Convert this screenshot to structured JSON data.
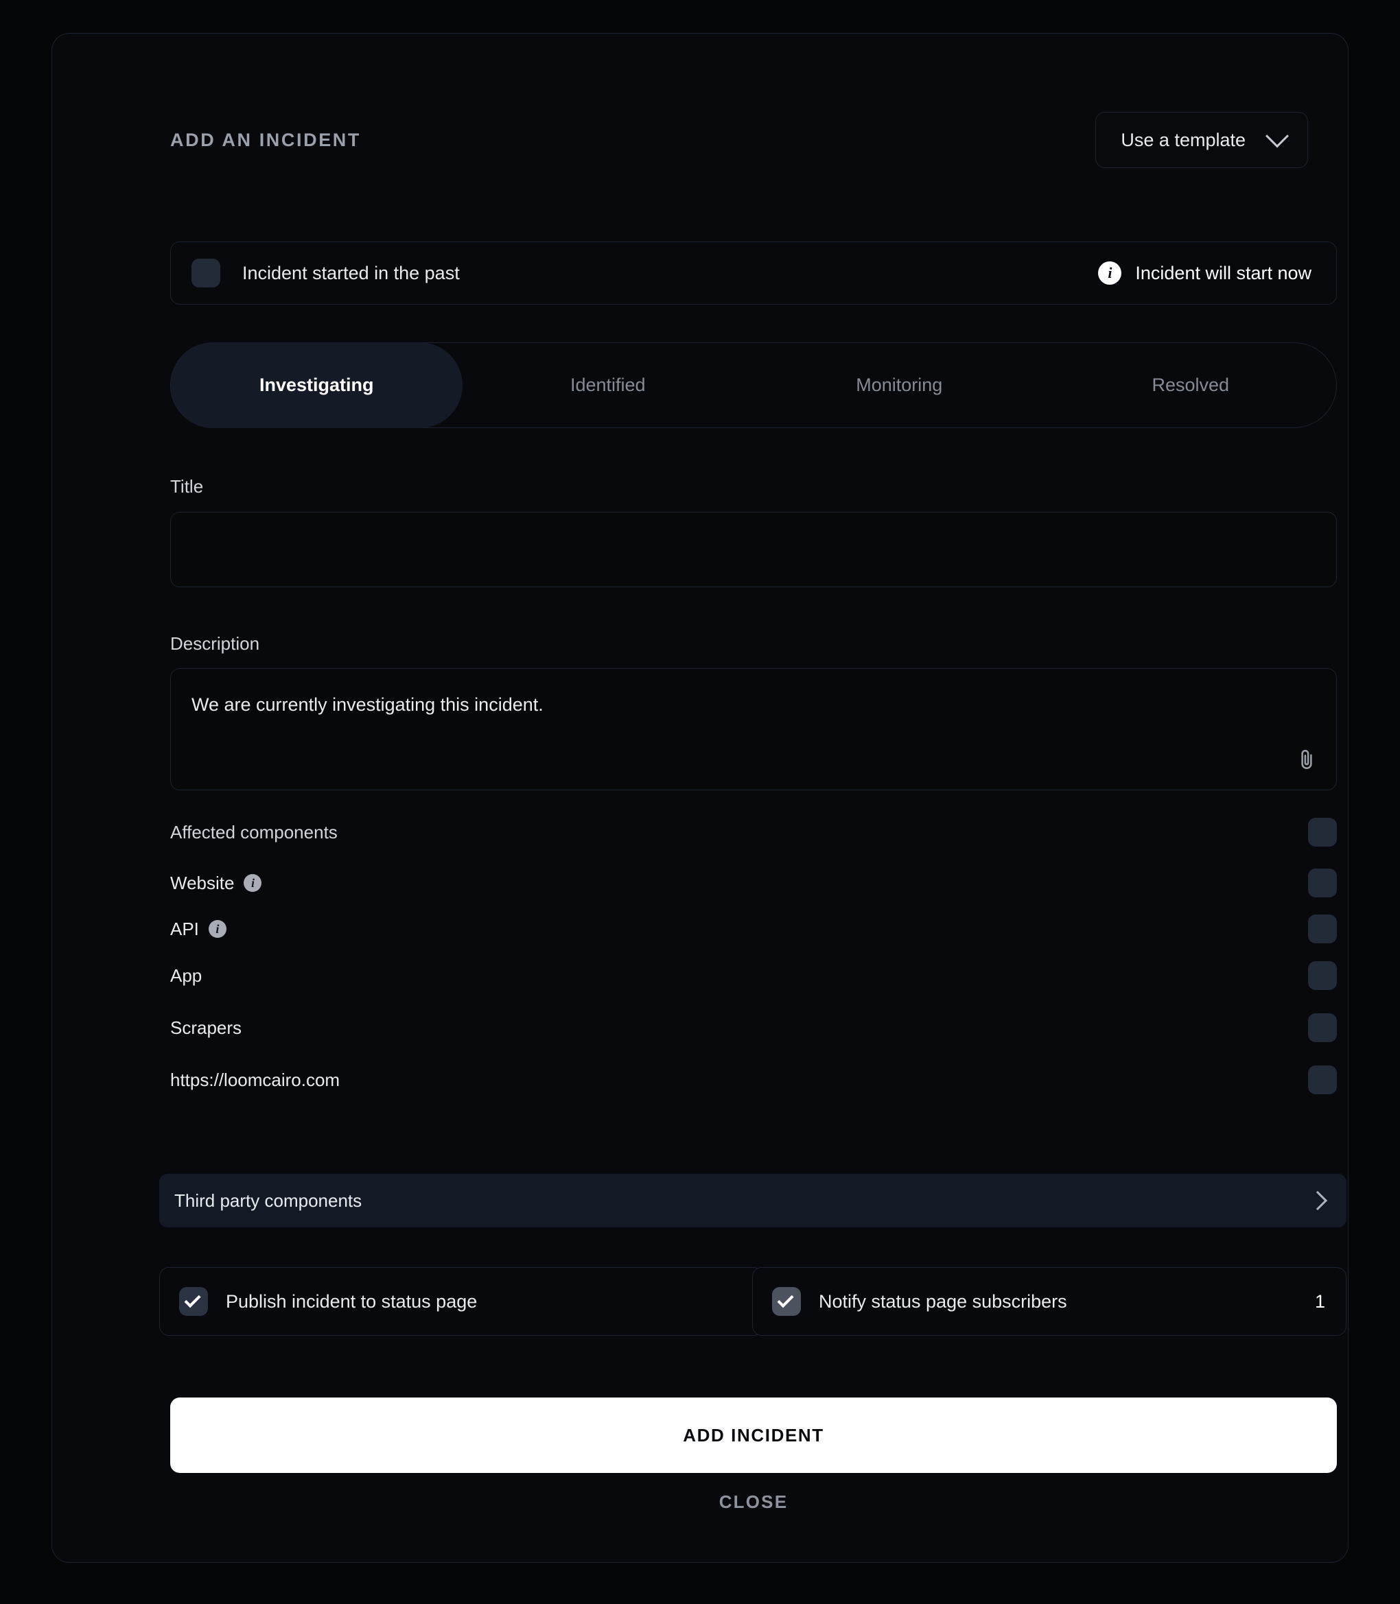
{
  "header": {
    "title": "ADD AN INCIDENT",
    "template_button": "Use a template",
    "chevron_icon": "chevron-down-icon"
  },
  "past_incident": {
    "checkbox_label": "Incident started in the past",
    "checked": false,
    "status_note": "Incident will start now",
    "status_icon": "info-icon"
  },
  "status_tabs": {
    "items": [
      {
        "label": "Investigating",
        "active": true
      },
      {
        "label": "Identified",
        "active": false
      },
      {
        "label": "Monitoring",
        "active": false
      },
      {
        "label": "Resolved",
        "active": false
      }
    ]
  },
  "title_field": {
    "label": "Title",
    "value": "",
    "placeholder": ""
  },
  "description_field": {
    "label": "Description",
    "value": "We are currently investigating this incident.",
    "attach_icon": "paperclip-icon"
  },
  "affected_components": {
    "header_label": "Affected components",
    "header_checked": false,
    "items": [
      {
        "label": "Website",
        "has_info": true,
        "checked": false
      },
      {
        "label": "API",
        "has_info": true,
        "checked": false
      },
      {
        "label": "App",
        "has_info": false,
        "checked": false
      },
      {
        "label": "Scrapers",
        "has_info": false,
        "checked": false
      },
      {
        "label": "https://loomcairo.com",
        "has_info": false,
        "checked": false
      }
    ]
  },
  "third_party": {
    "label": "Third party components",
    "chevron_icon": "chevron-right-icon"
  },
  "publish": {
    "label": "Publish incident to status page",
    "checked": true
  },
  "notify": {
    "label": "Notify status page subscribers",
    "checked": true,
    "count": "1"
  },
  "actions": {
    "primary": "ADD INCIDENT",
    "secondary": "CLOSE"
  },
  "colors": {
    "page_background": "#050608",
    "card_background": "#08090c",
    "card_border": "#1c2230",
    "active_tab": "#141b26",
    "checkbox_off": "#232a38",
    "checkbox_on_gray": "#4c525e",
    "third_party_row": "#131a26",
    "primary_button": "#ffffff",
    "text_primary": "#e9ecef",
    "text_muted": "#858c96"
  }
}
